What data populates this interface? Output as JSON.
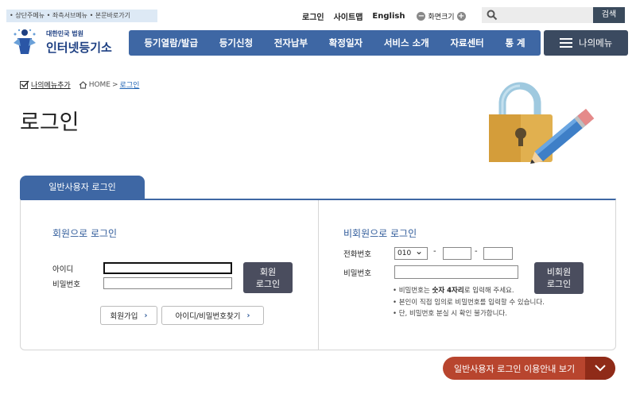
{
  "skip_links": "• 상단주메뉴  • 좌측서브메뉴  • 본문바로가기",
  "utility": {
    "login": "로그인",
    "sitemap": "사이트맵",
    "english": "English",
    "zoom_label": "화면크기",
    "zoom_out": "−",
    "zoom_in": "+"
  },
  "search": {
    "button": "검색",
    "placeholder": ""
  },
  "logo": {
    "line1": "대한민국 법원",
    "line2": "인터넷등기소"
  },
  "nav": {
    "items": [
      "등기열람/발급",
      "등기신청",
      "전자납부",
      "확정일자",
      "서비스 소개",
      "자료센터",
      "통 계"
    ],
    "my_menu": "나의메뉴"
  },
  "breadcrumb": {
    "add": "나의메뉴추가",
    "home": "HOME",
    "sep": ">",
    "current": "로그인"
  },
  "page_title": "로그인",
  "tab": {
    "label": "일반사용자 로그인"
  },
  "member": {
    "heading": "회원으로 로그인",
    "id_label": "아이디",
    "pw_label": "비밀번호",
    "login_button_line1": "회원",
    "login_button_line2": "로그인",
    "join_button": "회원가입",
    "find_button": "아이디/비밀번호찾기",
    "arrow": "›"
  },
  "nonmember": {
    "heading": "비회원으로 로그인",
    "phone_label": "전화번호",
    "phone_prefix": "010",
    "dash": "-",
    "pw_label": "비밀번호",
    "login_button_line1": "비회원",
    "login_button_line2": "로그인",
    "notes": [
      {
        "pre": "• 비밀번호는 ",
        "bold": "숫자 4자리",
        "post": "로 입력해 주세요."
      },
      {
        "pre": "• 본인이 직접 임의로 비밀번호를 입력할 수 있습니다.",
        "bold": "",
        "post": ""
      },
      {
        "pre": "• 단, 비밀번호 분실 시 확인 불가합니다.",
        "bold": "",
        "post": ""
      }
    ]
  },
  "guide_button": {
    "label": "일반사용자 로그인 이용안내 보기",
    "icon": "chevron-down-icon"
  },
  "colors": {
    "nav_blue": "#3e67a4",
    "dark_button": "#4a4d5e",
    "guide_red": "#b8452e"
  }
}
